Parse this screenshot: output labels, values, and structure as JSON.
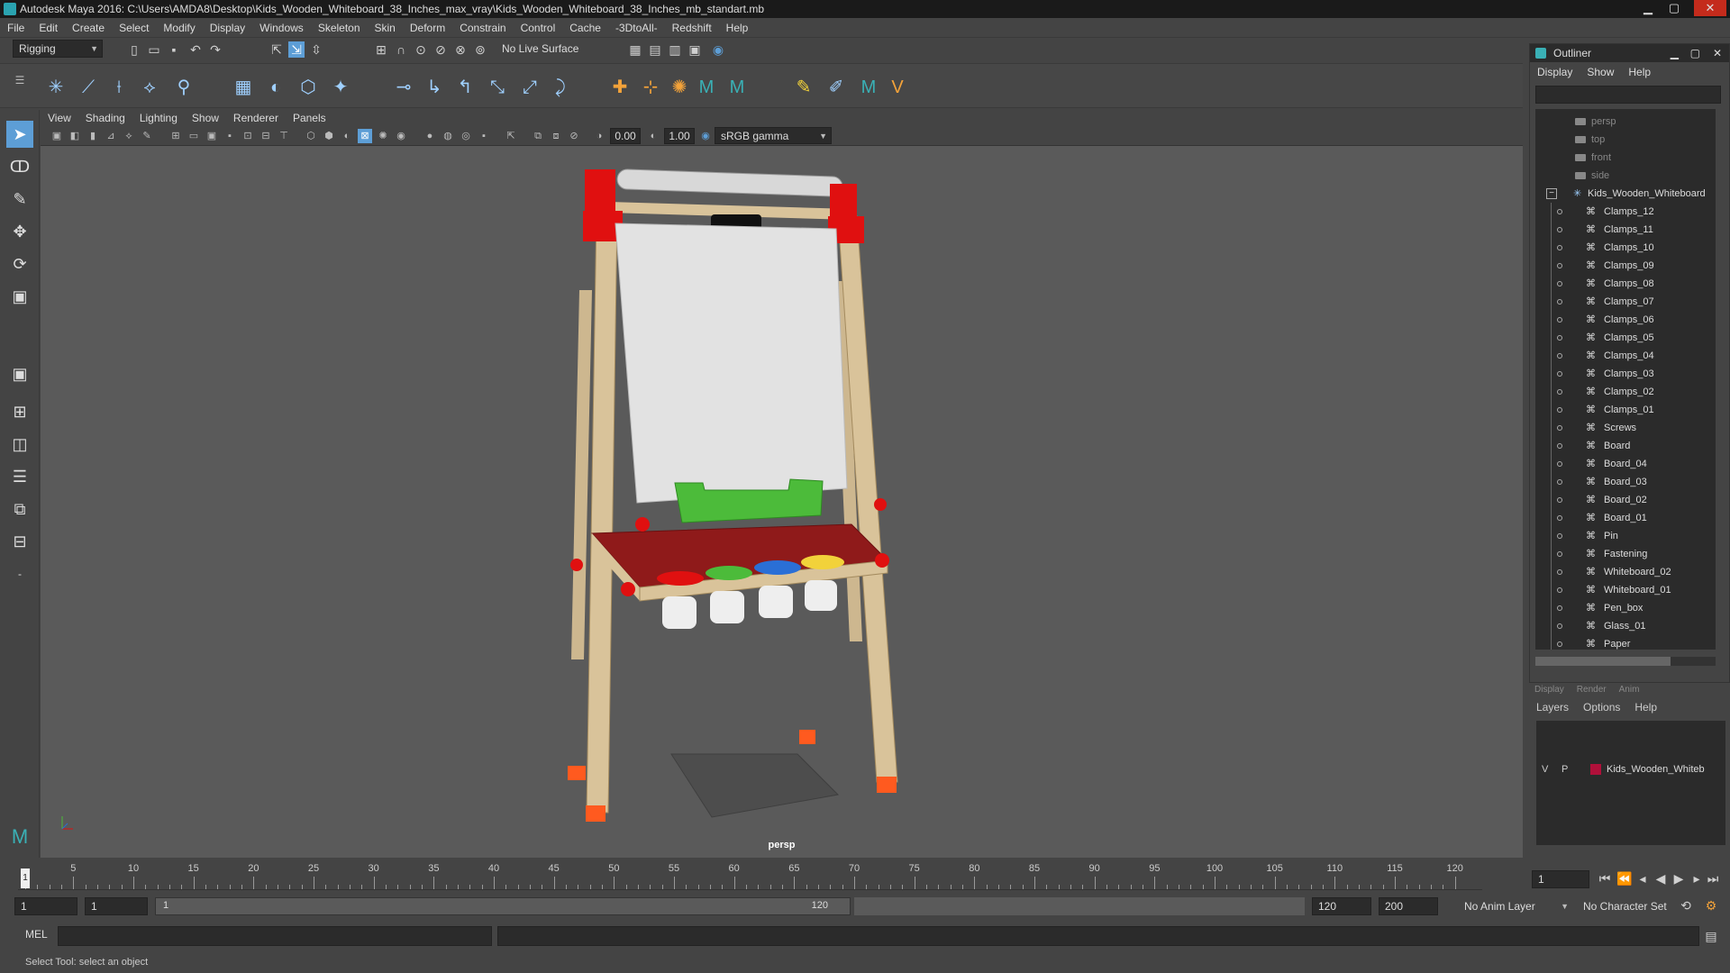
{
  "window": {
    "title": "Autodesk Maya 2016: C:\\Users\\AMDA8\\Desktop\\Kids_Wooden_Whiteboard_38_Inches_max_vray\\Kids_Wooden_Whiteboard_38_Inches_mb_standart.mb",
    "minimize": "▁",
    "maximize": "▢",
    "close": "✕"
  },
  "menubar": [
    "File",
    "Edit",
    "Create",
    "Select",
    "Modify",
    "Display",
    "Windows",
    "Skeleton",
    "Skin",
    "Deform",
    "Constrain",
    "Control",
    "Cache",
    "-3DtoAll-",
    "Redshift",
    "Help"
  ],
  "statusline": {
    "menuset": "Rigging",
    "live_surface": "No Live Surface"
  },
  "panel": {
    "menu": [
      "View",
      "Shading",
      "Lighting",
      "Show",
      "Renderer",
      "Panels"
    ],
    "exposure": "0.00",
    "gamma": "1.00",
    "colorspace": "sRGB gamma",
    "camera": "persp"
  },
  "outliner": {
    "title": "Outliner",
    "menu": [
      "Display",
      "Show",
      "Help"
    ],
    "cameras": [
      "persp",
      "top",
      "front",
      "side"
    ],
    "group": "Kids_Wooden_Whiteboard",
    "items": [
      "Clamps_12",
      "Clamps_11",
      "Clamps_10",
      "Clamps_09",
      "Clamps_08",
      "Clamps_07",
      "Clamps_06",
      "Clamps_05",
      "Clamps_04",
      "Clamps_03",
      "Clamps_02",
      "Clamps_01",
      "Screws",
      "Board",
      "Board_04",
      "Board_03",
      "Board_02",
      "Board_01",
      "Pin",
      "Fastening",
      "Whiteboard_02",
      "Whiteboard_01",
      "Pen_box",
      "Glass_01",
      "Paper"
    ]
  },
  "layers": {
    "tabs": [
      "Display",
      "Render",
      "Anim"
    ],
    "menu": [
      "Layers",
      "Options",
      "Help"
    ],
    "layer": {
      "v": "V",
      "p": "P",
      "name": "Kids_Wooden_Whiteb",
      "color": "#b0103a"
    }
  },
  "timeline": {
    "ticks": [
      1,
      5,
      10,
      15,
      20,
      25,
      30,
      35,
      40,
      45,
      50,
      55,
      60,
      65,
      70,
      75,
      80,
      85,
      90,
      95,
      100,
      105,
      110,
      115,
      120
    ],
    "labels": [
      "5",
      "10",
      "15",
      "20",
      "25",
      "30",
      "35",
      "40",
      "45",
      "50",
      "55",
      "60",
      "65",
      "70",
      "75",
      "80",
      "85",
      "90",
      "95",
      "100",
      "105",
      "110",
      "115",
      "120"
    ],
    "current_marker": "1",
    "current_frame": "1"
  },
  "range": {
    "start": "1",
    "playback_start": "1",
    "slider_start": "1",
    "slider_end": "120",
    "playback_end": "120",
    "end": "200",
    "anim_layer": "No Anim Layer",
    "char_set": "No Character Set"
  },
  "cmdline": {
    "lang": "MEL"
  },
  "helpline": "Select Tool: select an object",
  "colors": {
    "accent": "#5d9ed6",
    "wood": "#d9c39a",
    "red": "#e01010",
    "board": "#e2e2e2",
    "green": "#4cbb3a",
    "tray": "#8f1a1a"
  }
}
